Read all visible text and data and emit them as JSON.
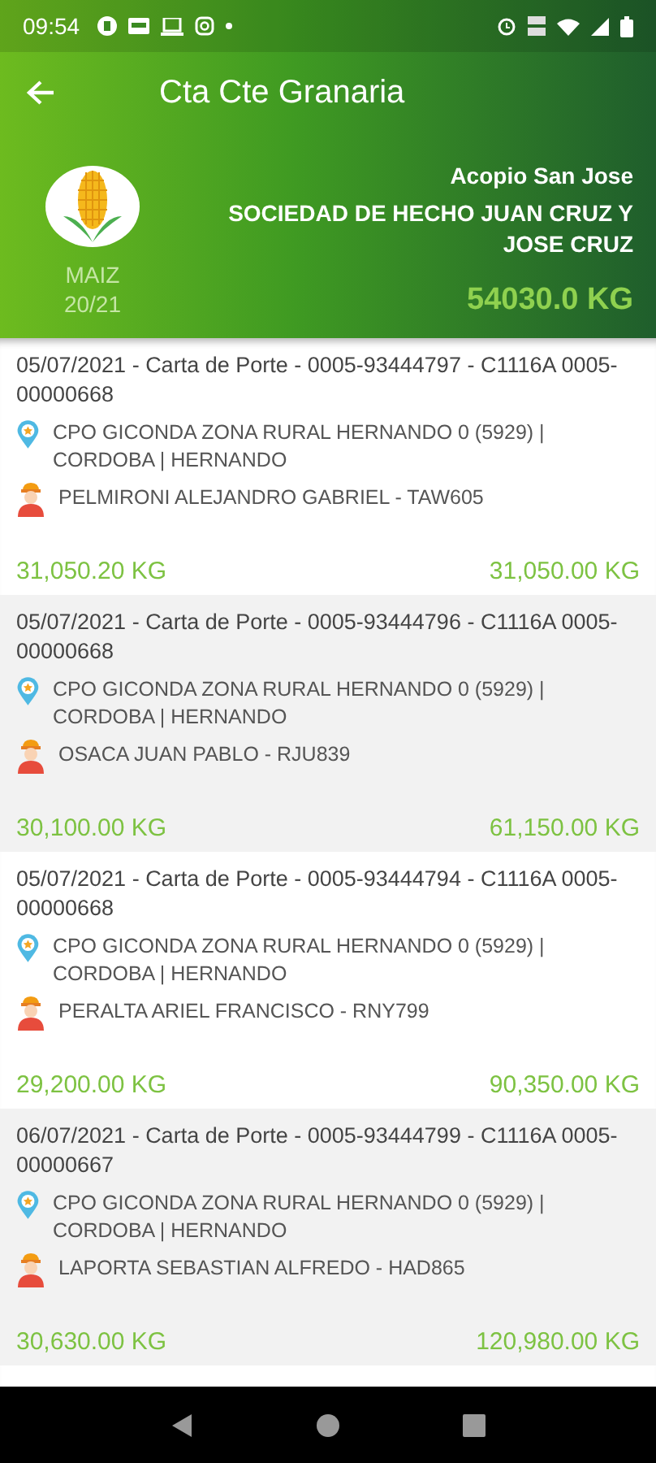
{
  "status_bar": {
    "time": "09:54"
  },
  "header": {
    "title": "Cta Cte Granaria",
    "crop": "MAIZ",
    "season": "20/21",
    "site": "Acopio San Jose",
    "company": "SOCIEDAD DE HECHO JUAN CRUZ Y JOSE CRUZ",
    "total": "54030.0 KG"
  },
  "entries": [
    {
      "title": "05/07/2021  -  Carta de Porte - 0005-93444797 - C1116A 0005-00000668",
      "location": "CPO GICONDA ZONA RURAL HERNANDO 0 (5929)  |  CORDOBA  |  HERNANDO",
      "driver": "PELMIRONI ALEJANDRO GABRIEL  -  TAW605",
      "weight": "31,050.20 KG",
      "cumulative": "31,050.00 KG"
    },
    {
      "title": "05/07/2021  -  Carta de Porte - 0005-93444796 - C1116A 0005-00000668",
      "location": "CPO GICONDA ZONA RURAL HERNANDO 0 (5929)  |  CORDOBA  |  HERNANDO",
      "driver": "OSACA JUAN PABLO  -  RJU839",
      "weight": "30,100.00 KG",
      "cumulative": "61,150.00 KG"
    },
    {
      "title": "05/07/2021  -  Carta de Porte - 0005-93444794 - C1116A 0005-00000668",
      "location": "CPO GICONDA ZONA RURAL HERNANDO 0 (5929)  |  CORDOBA  |  HERNANDO",
      "driver": "PERALTA ARIEL FRANCISCO  -  RNY799",
      "weight": "29,200.00 KG",
      "cumulative": "90,350.00 KG"
    },
    {
      "title": "06/07/2021  -  Carta de Porte - 0005-93444799 - C1116A 0005-00000667",
      "location": "CPO GICONDA ZONA RURAL HERNANDO 0 (5929)  |  CORDOBA  |  HERNANDO",
      "driver": "LAPORTA SEBASTIAN ALFREDO  -  HAD865",
      "weight": "30,630.00 KG",
      "cumulative": "120,980.00 KG"
    }
  ]
}
